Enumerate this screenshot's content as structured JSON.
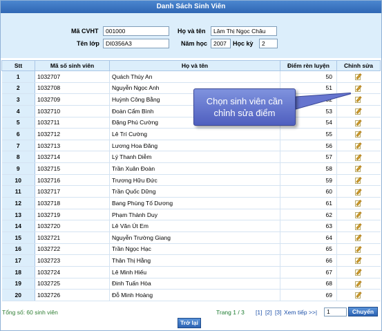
{
  "window": {
    "title": "Danh Sách Sinh Viên"
  },
  "filter": {
    "cvht_label": "Mã CVHT",
    "cvht_value": "001000",
    "hoten_label": "Họ và tên",
    "hoten_value": "Lâm Thị Ngọc Châu",
    "lop_label": "Tên lớp",
    "lop_value": "DI0356A3",
    "namhoc_label": "Năm học",
    "namhoc_value": "2007",
    "hocky_label": "Học kỳ",
    "hocky_value": "2"
  },
  "table": {
    "headers": [
      "Stt",
      "Mã số sinh viên",
      "Họ và tên",
      "Điểm rèn luyện",
      "Chỉnh sửa"
    ],
    "rows": [
      {
        "stt": "1",
        "msv": "1032707",
        "name": "Quách Thúy An",
        "score": "50"
      },
      {
        "stt": "2",
        "msv": "1032708",
        "name": "Nguyễn Ngọc Anh",
        "score": "51"
      },
      {
        "stt": "3",
        "msv": "1032709",
        "name": "Huỳnh Công Bằng",
        "score": "52"
      },
      {
        "stt": "4",
        "msv": "1032710",
        "name": "Đoàn Cẩm Bình",
        "score": "53"
      },
      {
        "stt": "5",
        "msv": "1032711",
        "name": "Đặng Phú Cường",
        "score": "54"
      },
      {
        "stt": "6",
        "msv": "1032712",
        "name": "Lê Trí Cường",
        "score": "55"
      },
      {
        "stt": "7",
        "msv": "1032713",
        "name": "Lương Hoa Đăng",
        "score": "56"
      },
      {
        "stt": "8",
        "msv": "1032714",
        "name": "Lý Thanh Diễm",
        "score": "57"
      },
      {
        "stt": "9",
        "msv": "1032715",
        "name": "Trần Xuân Đoàn",
        "score": "58"
      },
      {
        "stt": "10",
        "msv": "1032716",
        "name": "Trương Hữu Đức",
        "score": "59"
      },
      {
        "stt": "11",
        "msv": "1032717",
        "name": "Trần Quốc Dững",
        "score": "60"
      },
      {
        "stt": "12",
        "msv": "1032718",
        "name": "Bang Phùng Tố Dương",
        "score": "61"
      },
      {
        "stt": "13",
        "msv": "1032719",
        "name": "Phạm Thành Duy",
        "score": "62"
      },
      {
        "stt": "14",
        "msv": "1032720",
        "name": "Lê Văn Út Em",
        "score": "63"
      },
      {
        "stt": "15",
        "msv": "1032721",
        "name": "Nguyễn Trường Giang",
        "score": "64"
      },
      {
        "stt": "16",
        "msv": "1032722",
        "name": "Trần Ngọc Hạc",
        "score": "65"
      },
      {
        "stt": "17",
        "msv": "1032723",
        "name": "Thân Thị Hằng",
        "score": "66"
      },
      {
        "stt": "18",
        "msv": "1032724",
        "name": "Lê Minh Hiếu",
        "score": "67"
      },
      {
        "stt": "19",
        "msv": "1032725",
        "name": "Đinh Tuấn Hòa",
        "score": "68"
      },
      {
        "stt": "20",
        "msv": "1032726",
        "name": "Đỗ Minh Hoàng",
        "score": "69"
      }
    ],
    "edit_icon": "edit-note-icon"
  },
  "footer": {
    "total": "Tổng số: 60 sinh viên",
    "page_info": "Trang 1 / 3",
    "pages": [
      "[1]",
      "[2]",
      "[3]"
    ],
    "next_label": "Xem tiếp >>|",
    "page_input": "1",
    "go_button": "Chuyển",
    "back_button": "Trở lại"
  },
  "callout": {
    "line1": "Chọn sinh viên cần",
    "line2": "chỉnh sửa điểm"
  },
  "colors": {
    "title_bar": "#2f67b4",
    "panel": "#dceefb",
    "total_text": "#2e7d32",
    "link": "#1c4fa8",
    "callout": "#5f70cc"
  }
}
